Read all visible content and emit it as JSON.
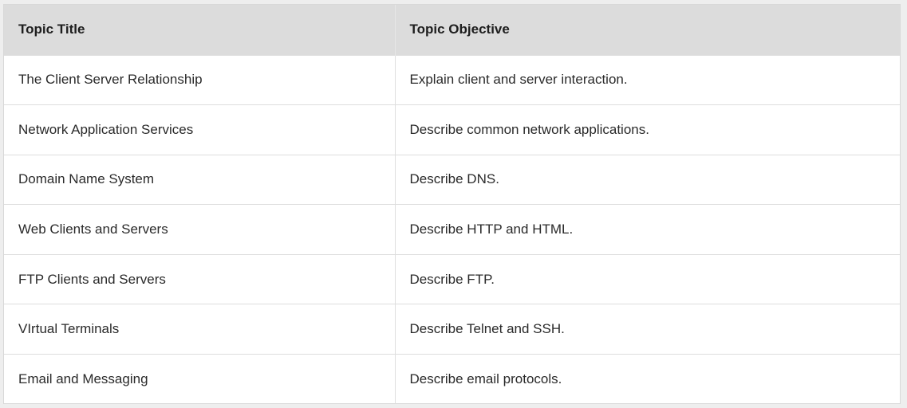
{
  "table": {
    "headers": [
      "Topic Title",
      "Topic Objective"
    ],
    "rows": [
      {
        "title": "The Client Server Relationship",
        "objective": "Explain client and server interaction."
      },
      {
        "title": "Network Application Services",
        "objective": "Describe common network applications."
      },
      {
        "title": "Domain Name System",
        "objective": "Describe DNS."
      },
      {
        "title": "Web Clients and Servers",
        "objective": "Describe HTTP and HTML."
      },
      {
        "title": "FTP Clients and Servers",
        "objective": "Describe FTP."
      },
      {
        "title": "VIrtual Terminals",
        "objective": "Describe Telnet and SSH."
      },
      {
        "title": "Email and Messaging",
        "objective": "Describe email protocols."
      }
    ]
  },
  "colors": {
    "header_bg": "#dcdcdc",
    "row_bg": "#ffffff",
    "border": "#dedede",
    "page_bg": "#eeeeee"
  }
}
